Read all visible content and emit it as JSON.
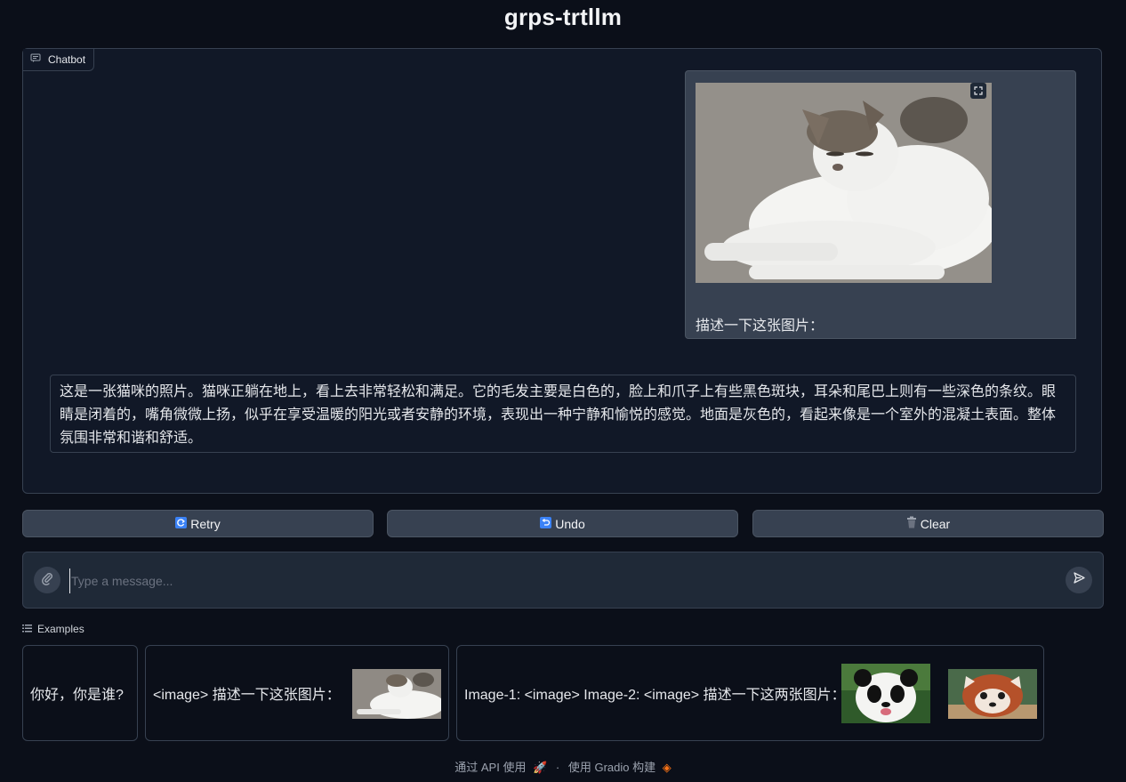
{
  "app": {
    "title": "grps-trtllm"
  },
  "chatbot": {
    "label": "Chatbot",
    "user_message": {
      "text": "描述一下这张图片："
    },
    "bot_message": {
      "text": "这是一张猫咪的照片。猫咪正躺在地上，看上去非常轻松和满足。它的毛发主要是白色的，脸上和爪子上有些黑色斑块，耳朵和尾巴上则有一些深色的条纹。眼睛是闭着的，嘴角微微上扬，似乎在享受温暖的阳光或者安静的环境，表现出一种宁静和愉悦的感觉。地面是灰色的，看起来像是一个室外的混凝土表面。整体氛围非常和谐和舒适。"
    }
  },
  "actions": {
    "retry": "Retry",
    "undo": "Undo",
    "clear": "Clear"
  },
  "input": {
    "placeholder": "Type a message..."
  },
  "examples": {
    "label": "Examples",
    "items": [
      {
        "text": "你好，你是谁?"
      },
      {
        "text": "<image> 描述一下这张图片："
      },
      {
        "text": "Image-1: <image> Image-2: <image> 描述一下这两张图片："
      }
    ]
  },
  "footer": {
    "api": "通过 API 使用",
    "separator": "·",
    "built": "使用 Gradio 构建"
  },
  "colors": {
    "background": "#0b0f19",
    "panel": "#111827",
    "button": "#374151",
    "accent": "#f97316"
  }
}
